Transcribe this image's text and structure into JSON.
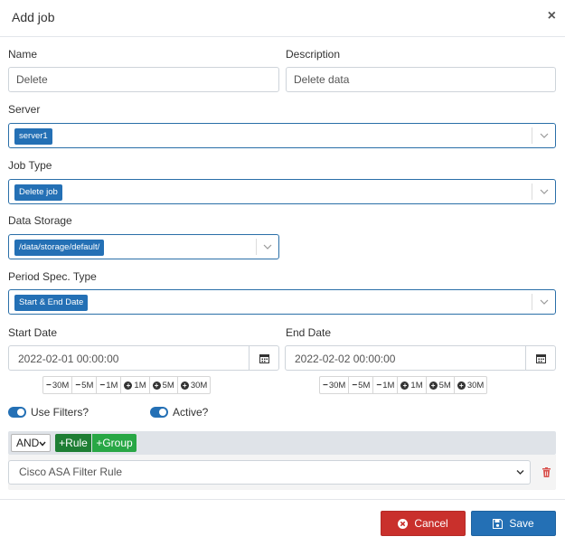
{
  "modal": {
    "title": "Add job",
    "close_glyph": "×"
  },
  "fields": {
    "name": {
      "label": "Name",
      "value": "Delete"
    },
    "description": {
      "label": "Description",
      "value": "Delete data"
    },
    "server": {
      "label": "Server",
      "chip": "server1"
    },
    "job_type": {
      "label": "Job Type",
      "chip": "Delete job"
    },
    "data_storage": {
      "label": "Data Storage",
      "chip": "/data/storage/default/"
    },
    "period_spec_type": {
      "label": "Period Spec. Type",
      "chip": "Start & End Date"
    },
    "start_date": {
      "label": "Start Date",
      "value": "2022-02-01 00:00:00"
    },
    "end_date": {
      "label": "End Date",
      "value": "2022-02-02 00:00:00"
    }
  },
  "date_steps": [
    {
      "label": "30M",
      "kind": "minus"
    },
    {
      "label": "5M",
      "kind": "minus"
    },
    {
      "label": "1M",
      "kind": "minus"
    },
    {
      "label": "1M",
      "kind": "plus"
    },
    {
      "label": "5M",
      "kind": "plus"
    },
    {
      "label": "30M",
      "kind": "plus"
    }
  ],
  "toggles": {
    "use_filters": {
      "label": "Use Filters?",
      "on": true
    },
    "active": {
      "label": "Active?",
      "on": true
    }
  },
  "query_builder": {
    "condition": "AND",
    "add_rule_label": "+Rule",
    "add_group_label": "+Group",
    "rule_value": "Cisco ASA Filter Rule"
  },
  "footer": {
    "cancel_label": "Cancel",
    "save_label": "Save"
  },
  "colors": {
    "primary": "#2470b5",
    "danger": "#c9302c",
    "success": "#28a745",
    "success_dark": "#1e7e34"
  }
}
